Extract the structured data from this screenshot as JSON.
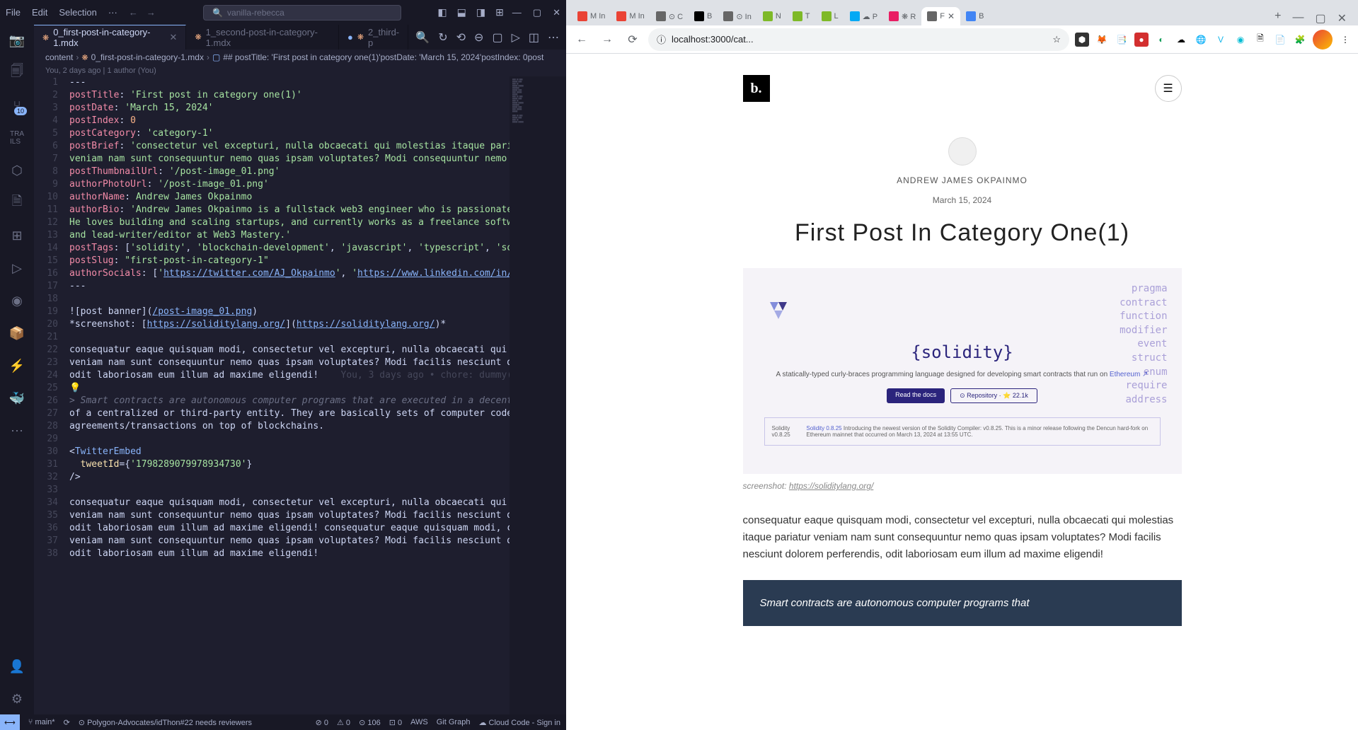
{
  "vscode": {
    "menu": [
      "File",
      "Edit",
      "Selection",
      "···"
    ],
    "search_placeholder": "vanilla-rebecca",
    "tabs": [
      {
        "name": "0_first-post-in-category-1.mdx",
        "active": true,
        "modified": true
      },
      {
        "name": "1_second-post-in-category-1.mdx",
        "active": false
      },
      {
        "name": "2_third-p",
        "active": false,
        "modified": true
      }
    ],
    "breadcrumb": [
      "content",
      "0_first-post-in-category-1.mdx",
      "## postTitle: 'First post in category one(1)'postDate: 'March 15, 2024'postIndex: 0post"
    ],
    "gitlens": "You, 2 days ago | 1 author (You)",
    "code_lines": [
      {
        "n": 1,
        "html": "---"
      },
      {
        "n": 2,
        "html": "<span class='tok-key'>postTitle</span>: <span class='tok-string'>'First post in category one(1)'</span>"
      },
      {
        "n": 3,
        "html": "<span class='tok-key'>postDate</span>: <span class='tok-string'>'March 15, 2024'</span>"
      },
      {
        "n": 4,
        "html": "<span class='tok-key'>postIndex</span>: <span class='tok-num'>0</span>"
      },
      {
        "n": 5,
        "html": "<span class='tok-key'>postCategory</span>: <span class='tok-string'>'category-1'</span>"
      },
      {
        "n": 6,
        "html": "<span class='tok-key'>postBrief</span>: <span class='tok-string'>'consectetur vel excepturi, nulla obcaecati qui molestias itaque pariatu</span>"
      },
      {
        "n": 7,
        "html": "<span class='tok-string'>veniam nam sunt consequuntur nemo quas ipsam voluptates? Modi consequuntur nemo qua</span>"
      },
      {
        "n": 8,
        "html": "<span class='tok-key'>postThumbnailUrl</span>: <span class='tok-string'>'/post-image_01.png'</span>"
      },
      {
        "n": 9,
        "html": "<span class='tok-key'>authorPhotoUrl</span>: <span class='tok-string'>'/post-image_01.png'</span>"
      },
      {
        "n": 10,
        "html": "<span class='tok-key'>authorName</span>: <span class='tok-string'>Andrew James Okpainmo</span>"
      },
      {
        "n": 11,
        "html": "<span class='tok-key'>authorBio</span>: <span class='tok-string'>'Andrew James Okpainmo is a fullstack web3 engineer who is passionate ab</span>"
      },
      {
        "n": 12,
        "html": "<span class='tok-string'>He loves building and scaling startups, and currently works as a freelance software</span>"
      },
      {
        "n": 13,
        "html": "<span class='tok-string'>and lead-writer/editor at Web3 Mastery.'</span>"
      },
      {
        "n": 14,
        "html": "<span class='tok-key'>postTags</span>: [<span class='tok-string'>'solidity'</span>, <span class='tok-string'>'blockchain-development'</span>, <span class='tok-string'>'javascript'</span>, <span class='tok-string'>'typescript'</span>, <span class='tok-string'>'softw</span>"
      },
      {
        "n": 15,
        "html": "<span class='tok-key'>postSlug</span>: <span class='tok-string'>\"first-post-in-category-1\"</span>"
      },
      {
        "n": 16,
        "html": "<span class='tok-key'>authorSocials</span>: [<span class='tok-string'>'</span><span class='tok-link'>https://twitter.com/AJ_Okpainmo</span><span class='tok-string'>'</span>, <span class='tok-string'>'</span><span class='tok-link'>https://www.linkedin.com/in/okp</span>"
      },
      {
        "n": 17,
        "html": "---"
      },
      {
        "n": 18,
        "html": ""
      },
      {
        "n": 19,
        "html": "![post banner](<span class='tok-link'>/post-image_01.png</span>)"
      },
      {
        "n": 20,
        "html": "*screenshot: [<span class='tok-link'>https://soliditylang.org/</span>](<span class='tok-link'>https://soliditylang.org/</span>)*"
      },
      {
        "n": 21,
        "html": ""
      },
      {
        "n": 22,
        "html": "consequatur eaque quisquam modi, consectetur vel excepturi, nulla obcaecati qui mol"
      },
      {
        "n": 23,
        "html": "veniam nam sunt consequuntur nemo quas ipsam voluptates? Modi facilis nesciunt dolo"
      },
      {
        "n": 24,
        "html": "odit laboriosam eum illum ad maxime eligendi!    <span class='tok-dim'>You, 3 days ago • chore: dummy(</span>"
      },
      {
        "n": 25,
        "html": "💡"
      },
      {
        "n": 26,
        "html": "<span class='tok-comment'>> Smart contracts are autonomous computer programs that are executed in a decentral</span>"
      },
      {
        "n": 27,
        "html": "of a centralized or third-party entity. They are basically sets of computer codes t"
      },
      {
        "n": 28,
        "html": "agreements/transactions on top of blockchains."
      },
      {
        "n": 29,
        "html": ""
      },
      {
        "n": 30,
        "html": "&lt;<span class='tok-tag'>TwitterEmbed</span>"
      },
      {
        "n": 31,
        "html": "  <span class='tok-attr'>tweetId</span>={<span class='tok-string'>'1798289079978934730'</span>}"
      },
      {
        "n": 32,
        "html": "/&gt;"
      },
      {
        "n": 33,
        "html": ""
      },
      {
        "n": 34,
        "html": "consequatur eaque quisquam modi, consectetur vel excepturi, nulla obcaecati qui mol"
      },
      {
        "n": 35,
        "html": "veniam nam sunt consequuntur nemo quas ipsam voluptates? Modi facilis nesciunt dolo"
      },
      {
        "n": 36,
        "html": "odit laboriosam eum illum ad maxime eligendi! consequatur eaque quisquam modi, cons"
      },
      {
        "n": 37,
        "html": "veniam nam sunt consequuntur nemo quas ipsam voluptates? Modi facilis nesciunt dolo"
      },
      {
        "n": 38,
        "html": "odit laboriosam eum illum ad maxime eligendi!"
      }
    ],
    "statusbar": {
      "branch": "main*",
      "sync": "⟳",
      "pr": "Polygon-Advocates/idThon#22 needs reviewers",
      "errors": "⊘ 0",
      "warnings": "⚠ 0",
      "lines": "⊙ 106",
      "port": "⊡ 0",
      "aws": "AWS",
      "gitgraph": "Git Graph",
      "cloud": "☁ Cloud Code - Sign in"
    }
  },
  "browser": {
    "tabs": [
      {
        "label": "M In",
        "color": "#ea4335"
      },
      {
        "label": "M In",
        "color": "#ea4335"
      },
      {
        "label": "⊙ C",
        "color": "#666"
      },
      {
        "label": "B",
        "color": "#000"
      },
      {
        "label": "⊙ In",
        "color": "#666"
      },
      {
        "label": "N",
        "color": "#7eb928"
      },
      {
        "label": "T",
        "color": "#7eb928"
      },
      {
        "label": "L",
        "color": "#7eb928"
      },
      {
        "label": "☁ P",
        "color": "#03a9f4"
      },
      {
        "label": "❋ R",
        "color": "#e91e63"
      },
      {
        "label": "F",
        "color": "#666",
        "active": true
      },
      {
        "label": "B",
        "color": "#4285f4"
      }
    ],
    "url": "localhost:3000/cat...",
    "page": {
      "logo": "b.",
      "author": "ANDREW JAMES OKPAINMO",
      "date": "March 15, 2024",
      "title": "First Post In Category One(1)",
      "banner": {
        "title": "{solidity}",
        "desc": "A statically-typed curly-braces programming language designed for developing smart contracts that run on",
        "desc_link": "Ethereum ↗",
        "btn1": "Read the docs",
        "btn2": "⊙ Repository · ⭐ 22.1k",
        "box_label": "Solidity v0.8.25",
        "box_link": "Solidity 0.8.25",
        "box_text": "Introducing the newest version of the Solidity Compiler: v0.8.25. This is a minor release following the Dencun hard-fork on Ethereum mainnet that occurred on March 13, 2024 at 13:55 UTC.",
        "keywords": [
          "pragma",
          "contract",
          "function",
          "modifier",
          "event",
          "struct",
          "enum",
          "require",
          "address"
        ]
      },
      "caption_label": "screenshot:",
      "caption_link": "https://soliditylang.org/",
      "body": "consequatur eaque quisquam modi, consectetur vel excepturi, nulla obcaecati qui molestias itaque pariatur veniam nam sunt consequuntur nemo quas ipsam voluptates? Modi facilis nesciunt dolorem perferendis, odit laboriosam eum illum ad maxime eligendi!",
      "quote": "Smart contracts are autonomous computer programs that"
    }
  }
}
